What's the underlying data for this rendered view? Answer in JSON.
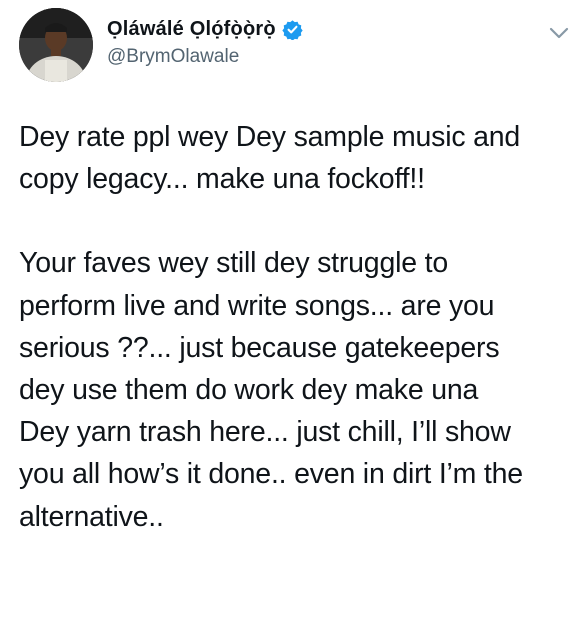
{
  "author": {
    "display_name": "Ọláwálé  Ọlọ́fọ̀ọ̀rọ̀",
    "handle": "@BrymOlawale",
    "verified": true
  },
  "icons": {
    "verified": "verified-badge-icon",
    "more": "chevron-down-icon"
  },
  "colors": {
    "verified_blue": "#1d9bf0",
    "handle_gray": "#536471",
    "text": "#0f1419"
  },
  "tweet": {
    "paragraphs": [
      {
        "lines": [
          "Dey rate ppl wey Dey sample music and",
          "copy legacy... make una fockoff!!"
        ]
      },
      {
        "lines": [
          "Your faves wey still dey struggle to",
          "perform live and write songs... are you",
          "serious ??... just because gatekeepers",
          "dey use them do work dey make una",
          "Dey yarn trash here... just chill, I’ll show",
          "you all how’s it done.. even in dirt I’m the",
          "alternative.."
        ]
      }
    ]
  }
}
